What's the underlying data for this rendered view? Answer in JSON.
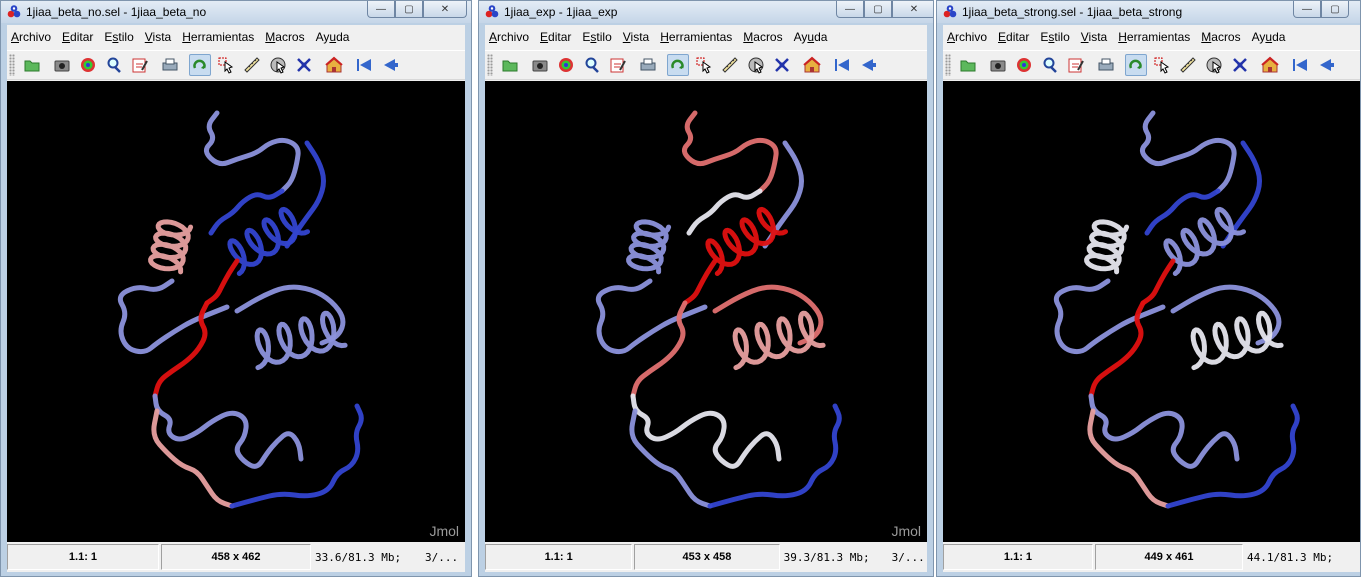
{
  "menu": [
    {
      "mnemonic": "A",
      "rest": "rchivo"
    },
    {
      "mnemonic": "E",
      "rest": "ditar"
    },
    {
      "mnemonic": "s",
      "prefix": "E",
      "rest": "tilo"
    },
    {
      "mnemonic": "V",
      "rest": "ista"
    },
    {
      "mnemonic": "H",
      "rest": "erramientas"
    },
    {
      "mnemonic": "M",
      "rest": "acros"
    },
    {
      "prefix": "Ay",
      "mnemonic": "u",
      "rest": "da"
    }
  ],
  "toolbar_icons": [
    "open-folder-icon",
    "camera-icon",
    "pov-ray-icon",
    "magnifier-icon",
    "edit-script-icon",
    "print-icon",
    "rotate-icon",
    "pick-icon",
    "ruler-icon",
    "spin-icon",
    "center-icon",
    "home-icon",
    "first-frame-icon",
    "previous-frame-icon"
  ],
  "window_controls": {
    "minimize": "—",
    "maximize": "▢",
    "close": "✕"
  },
  "windows": [
    {
      "title": "1jiaa_beta_no.sel - 1jiaa_beta_no",
      "watermark": "Jmol",
      "status": {
        "frame": "1.1: 1",
        "size": "458 x 462",
        "memory": "33.6/81.3 Mb;",
        "extra": "3/..."
      }
    },
    {
      "title": "1jiaa_exp - 1jiaa_exp",
      "watermark": "Jmol",
      "status": {
        "frame": "1.1: 1",
        "size": "453 x 458",
        "memory": "39.3/81.3 Mb;",
        "extra": "3/..."
      }
    },
    {
      "title": "1jiaa_beta_strong.sel - 1jiaa_beta_strong",
      "watermark": "",
      "status": {
        "frame": "1.1: 1",
        "size": "449 x 461",
        "memory": "44.1/81.3 Mb;",
        "extra": ""
      }
    }
  ],
  "colors": {
    "red": "#e01010",
    "blue": "#3344d0",
    "white": "#e6e6ee",
    "lightblue": "#8c92dc",
    "pink": "#e8a0a0",
    "salmon": "#e07070"
  }
}
